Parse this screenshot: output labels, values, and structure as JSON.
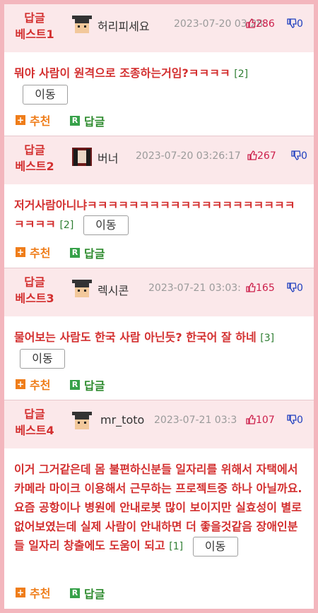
{
  "comments": [
    {
      "best_label": [
        "답글",
        "베스트1"
      ],
      "nickname": "허리피세요",
      "date": "2023-07-20 03:28:",
      "likes": "286",
      "dislikes": "0",
      "body": "뭐야 사람이 원격으로 조종하는거임?ㅋㅋㅋㅋ",
      "reply_count": "[2]",
      "move_label": "이동",
      "recommend_label": "추천",
      "reply_label": "답글"
    },
    {
      "best_label": [
        "답글",
        "베스트2"
      ],
      "nickname": "버너",
      "date": "2023-07-20 03:26:17",
      "likes": "267",
      "dislikes": "0",
      "body": "저거사람아니냐ㅋㅋㅋㅋㅋㅋㅋㅋㅋㅋㅋㅋㅋㅋㅋㅋㅋㅋㅋㅋㅋㅋㅋㅋ",
      "reply_count": "[2]",
      "move_label": "이동",
      "recommend_label": "추천",
      "reply_label": "답글"
    },
    {
      "best_label": [
        "답글",
        "베스트3"
      ],
      "nickname": "렉시콘",
      "date": "2023-07-21 03:03:",
      "likes": "165",
      "dislikes": "0",
      "body": "물어보는 사람도 한국 사람 아닌듯? 한국어 잘 하네",
      "reply_count": "[3]",
      "move_label": "이동",
      "recommend_label": "추천",
      "reply_label": "답글"
    },
    {
      "best_label": [
        "답글",
        "베스트4"
      ],
      "nickname": "mr_toto",
      "date": "2023-07-21 03:3",
      "likes": "107",
      "dislikes": "0",
      "body": "이거 그거같은데 몸 불편하신분들 일자리를 위해서 자택에서 카메라 마이크 이용해서 근무하는 프로젝트중 하나 아닐까요. 요즘 공항이나 병원에 안내로봇 많이 보이지만 실효성이 별로 없어보였는데 실제 사람이 안내하면 더 좋을것같음 장애인분들 일자리 창출에도 도움이 되고",
      "reply_count": "[1]",
      "move_label": "이동",
      "recommend_label": "추천",
      "reply_label": "답글"
    }
  ]
}
